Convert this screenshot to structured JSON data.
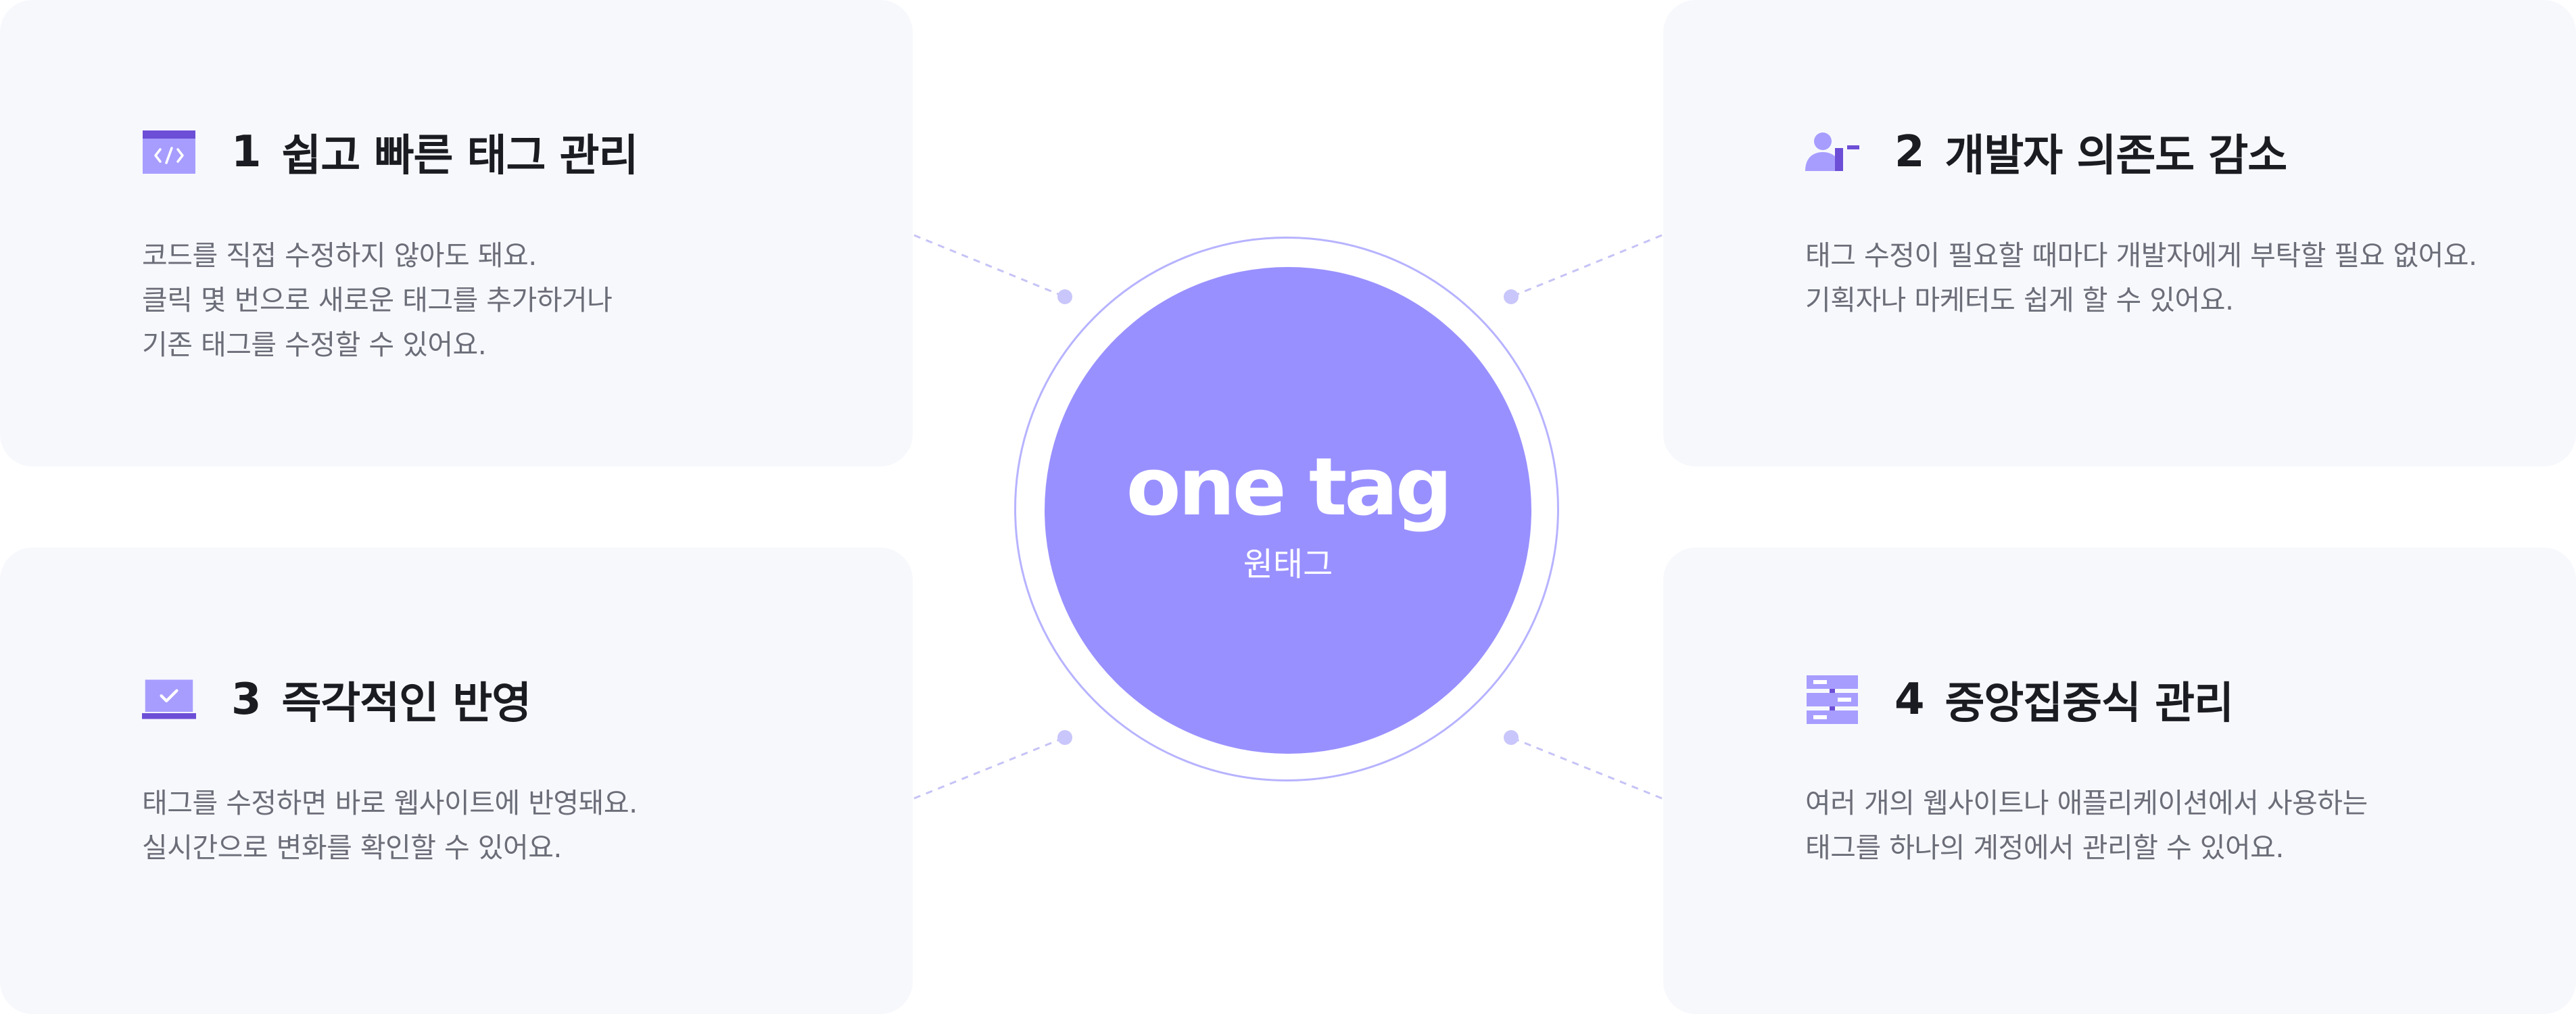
{
  "hub": {
    "title": "one tag",
    "subtitle": "원태그"
  },
  "features": [
    {
      "number": "1",
      "title": "쉽고 빠른 태그 관리",
      "icon": "code-window-icon",
      "lines": [
        "코드를 직접 수정하지 않아도 돼요.",
        "클릭 몇 번으로 새로운 태그를 추가하거나",
        "기존 태그를 수정할 수 있어요."
      ]
    },
    {
      "number": "2",
      "title": "개발자 의존도 감소",
      "icon": "user-minus-icon",
      "lines": [
        "태그 수정이 필요할 때마다 개발자에게 부탁할 필요 없어요.",
        "기획자나 마케터도 쉽게 할 수 있어요."
      ]
    },
    {
      "number": "3",
      "title": "즉각적인 반영",
      "icon": "laptop-check-icon",
      "lines": [
        "태그를 수정하면 바로 웹사이트에 반영돼요.",
        "실시간으로 변화를 확인할 수 있어요."
      ]
    },
    {
      "number": "4",
      "title": "중앙집중식 관리",
      "icon": "server-stack-icon",
      "lines": [
        "여러 개의 웹사이트나 애플리케이션에서 사용하는",
        "태그를 하나의 계정에서 관리할 수 있어요."
      ]
    }
  ],
  "colors": {
    "accent": "#9990ff",
    "accent_dark": "#6d4ed6",
    "card_background": "#f7f8fc",
    "title_text": "#1b1c22",
    "body_text": "#6b6d78"
  }
}
